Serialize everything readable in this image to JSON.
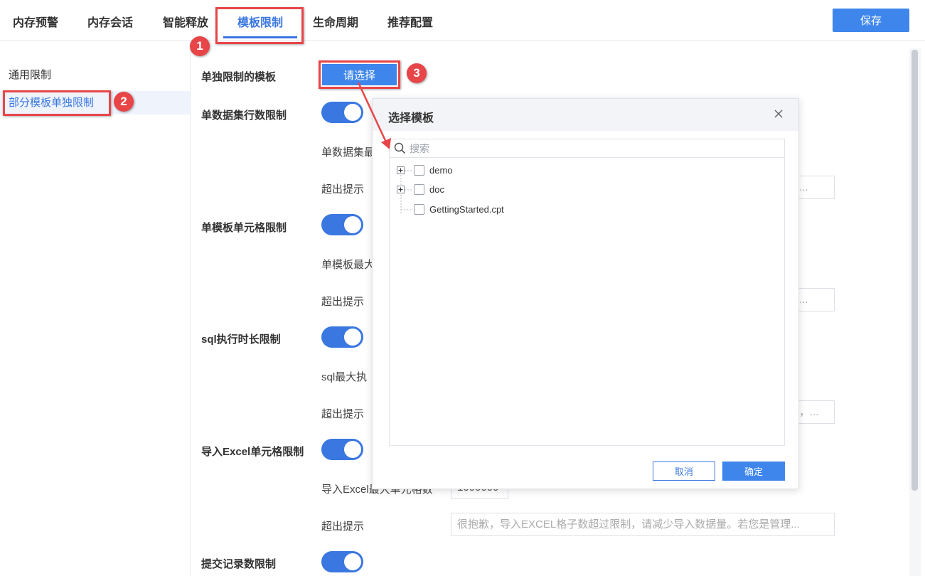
{
  "tabs": [
    {
      "label": "内存预警"
    },
    {
      "label": "内存会话"
    },
    {
      "label": "智能释放"
    },
    {
      "label": "模板限制"
    },
    {
      "label": "生命周期"
    },
    {
      "label": "推荐配置"
    }
  ],
  "active_tab": "模板限制",
  "save_label": "保存",
  "sidebar": {
    "items": [
      {
        "label": "通用限制"
      },
      {
        "label": "部分模板单独限制"
      }
    ]
  },
  "annotations": [
    "1",
    "2",
    "3"
  ],
  "main": {
    "template_label": "单独限制的模板",
    "choose_label": "请选择",
    "sections": [
      {
        "label": "单数据集行数限制",
        "sub1": "单数据集最",
        "sub2": "超出提示",
        "hint": "管..."
      },
      {
        "label": "单模板单元格限制",
        "sub1": "单模板最大",
        "sub2": "超出提示",
        "hint": "员..."
      },
      {
        "label": "sql执行时长限制",
        "sub1": "sql最大执",
        "sub2": "超出提示",
        "hint": "员，..."
      },
      {
        "label": "导入Excel单元格限制",
        "sub1": "导入Excel最大单元格数",
        "value1": "1000000",
        "sub2": "超出提示",
        "hint": "很抱歉，导入EXCEL格子数超过限制，请减少导入数据量。若您是管理..."
      },
      {
        "label": "提交记录数限制"
      }
    ]
  },
  "dialog": {
    "title": "选择模板",
    "search_placeholder": "搜索",
    "tree": [
      {
        "label": "demo"
      },
      {
        "label": "doc"
      },
      {
        "label": "GettingStarted.cpt"
      }
    ],
    "cancel_label": "取消",
    "ok_label": "确定"
  },
  "colors": {
    "accent": "#3a77e0",
    "button": "#3e86ec",
    "annotation": "#e84548"
  }
}
